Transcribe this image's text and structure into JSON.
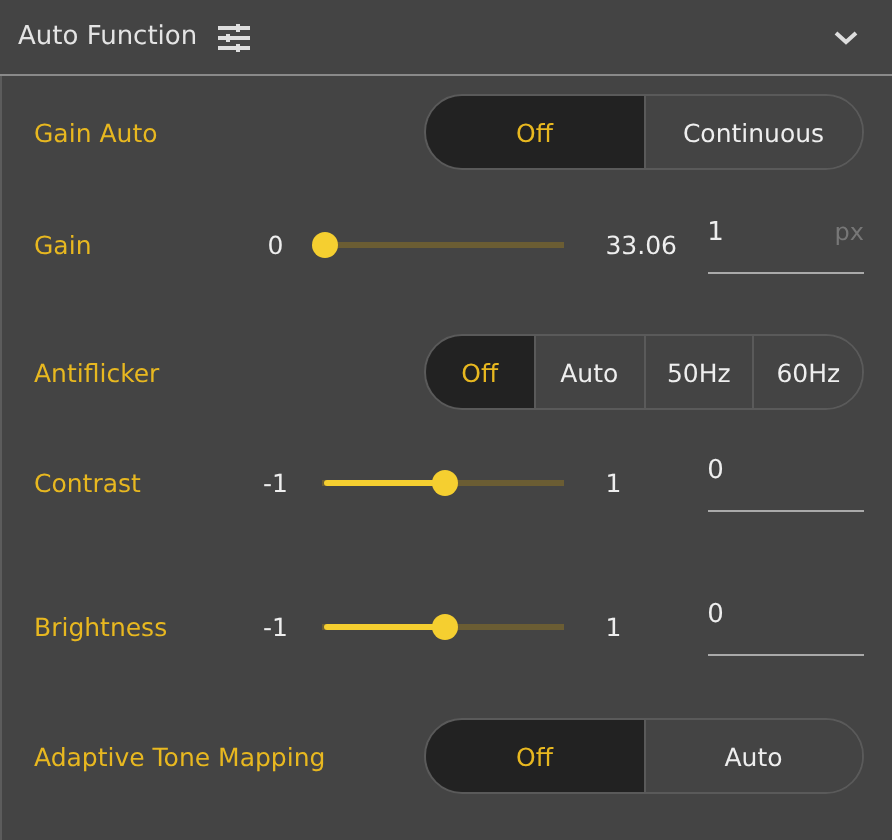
{
  "header": {
    "title": "Auto Function",
    "expanded": true
  },
  "rows": [
    {
      "kind": "segmented",
      "label": "Gain Auto",
      "options": [
        {
          "label": "Off",
          "selected": true
        },
        {
          "label": "Continuous",
          "selected": false
        }
      ]
    },
    {
      "kind": "slider",
      "label": "Gain",
      "min": "0",
      "max": "33.06",
      "level": 0,
      "value": "1",
      "unit": "px"
    },
    {
      "kind": "segmented",
      "label": "Antiflicker",
      "options": [
        {
          "label": "Off",
          "selected": true
        },
        {
          "label": "Auto",
          "selected": false
        },
        {
          "label": "50Hz",
          "selected": false
        },
        {
          "label": "60Hz",
          "selected": false
        }
      ]
    },
    {
      "kind": "slider",
      "label": "Contrast",
      "min": "-1",
      "max": "1",
      "level": 0.5,
      "value": "0"
    },
    {
      "kind": "slider",
      "label": "Brightness",
      "min": "-1",
      "max": "1",
      "level": 0.5,
      "value": "0"
    },
    {
      "kind": "segmented",
      "label": "Adaptive Tone Mapping",
      "options": [
        {
          "label": "Off",
          "selected": true
        },
        {
          "label": "Auto",
          "selected": false
        }
      ]
    }
  ]
}
